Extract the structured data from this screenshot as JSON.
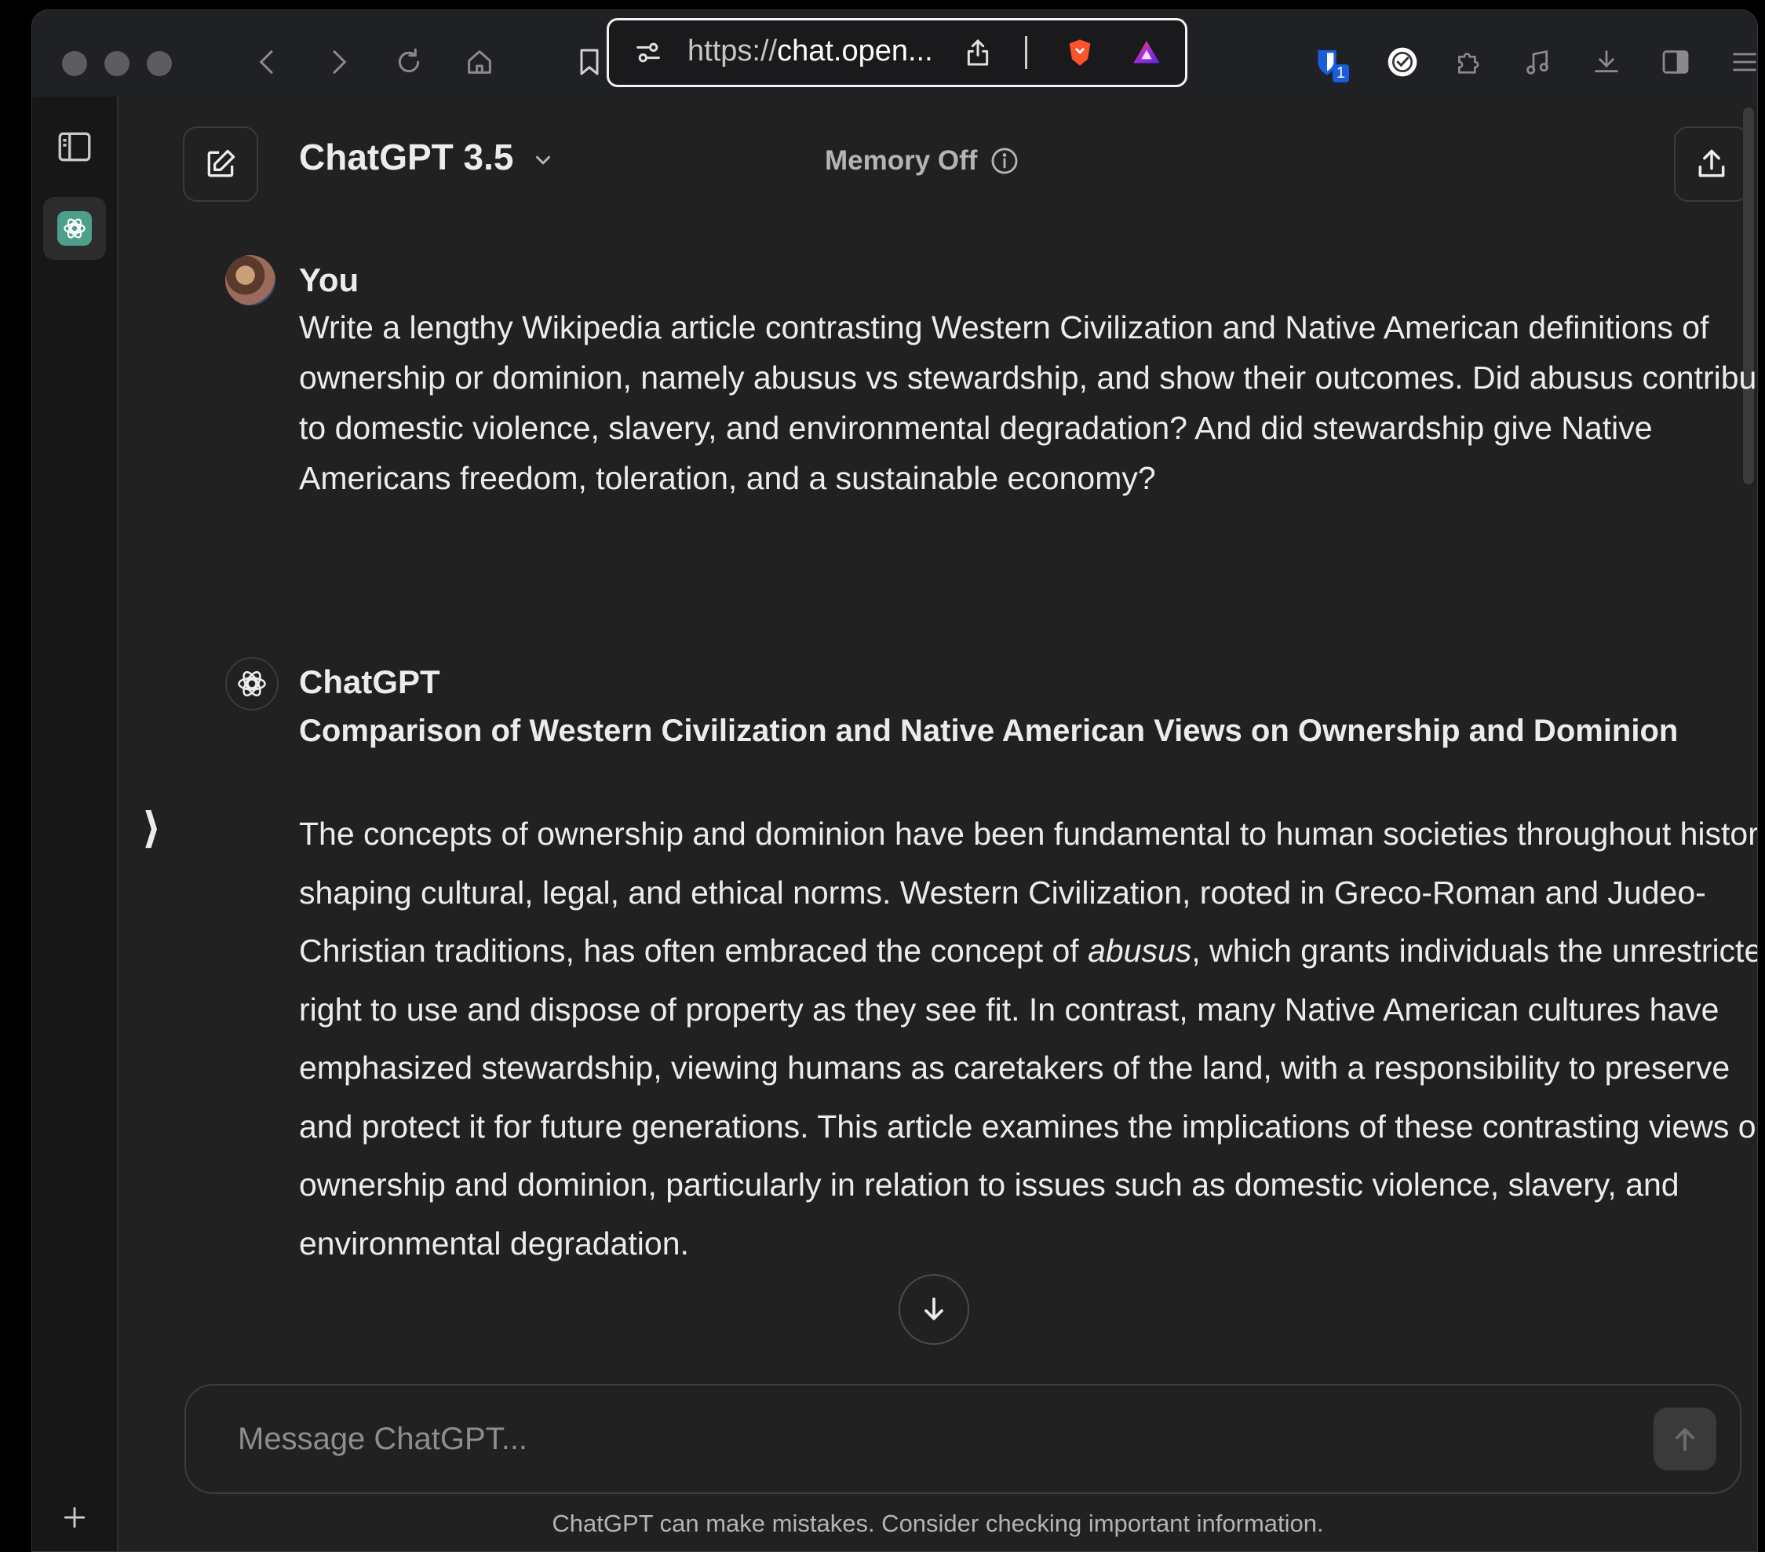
{
  "browser": {
    "url_scheme": "https://",
    "url_host": "chat.open...",
    "extension_badge": "1"
  },
  "header": {
    "model_name": "ChatGPT 3.5",
    "memory_label": "Memory Off"
  },
  "conversation": {
    "user": {
      "author": "You",
      "text": "Write a lengthy Wikipedia article contrasting Western Civilization and Native American definitions of ownership or dominion, namely abusus vs stewardship, and show their outcomes. Did abusus contribute to domestic violence, slavery, and environmental degradation? And did stewardship give Native Americans freedom, toleration, and a sustainable economy?"
    },
    "assistant": {
      "author": "ChatGPT",
      "title": "Comparison of Western Civilization and Native American Views on Ownership and Dominion",
      "body_part1": "The concepts of ownership and dominion have been fundamental to human societies throughout history, shaping cultural, legal, and ethical norms. Western Civilization, rooted in Greco-Roman and Judeo-Christian traditions, has often embraced the concept of ",
      "body_emphasis": "abusus",
      "body_part2": ", which grants individuals the unrestricted right to use and dispose of property as they see fit. In contrast, many Native American cultures have emphasized stewardship, viewing humans as caretakers of the land, with a responsibility to preserve and protect it for future generations. This article examines the implications of these contrasting views on ownership and dominion, particularly in relation to issues such as domestic violence, slavery, and environmental degradation."
    }
  },
  "composer": {
    "placeholder": "Message ChatGPT..."
  },
  "footer": {
    "disclaimer": "ChatGPT can make mistakes. Consider checking important information."
  },
  "icons": {
    "toolbar": [
      "back-icon",
      "forward-icon",
      "reload-icon",
      "home-icon",
      "bookmark-icon",
      "site-settings-icon",
      "share-icon",
      "brave-shield-icon",
      "brave-rewards-icon",
      "bitwarden-icon",
      "checkmark-extension-icon",
      "extensions-icon",
      "media-icon",
      "downloads-icon",
      "sidebar-toggle-icon",
      "menu-icon"
    ],
    "sidebar": [
      "sidebar-panel-icon",
      "chatgpt-logo-icon",
      "plus-icon"
    ]
  },
  "colors": {
    "background": "#212121",
    "rail": "#171717",
    "text": "#ececec",
    "muted": "#b4b4b4",
    "accent_green": "#10a37f"
  }
}
